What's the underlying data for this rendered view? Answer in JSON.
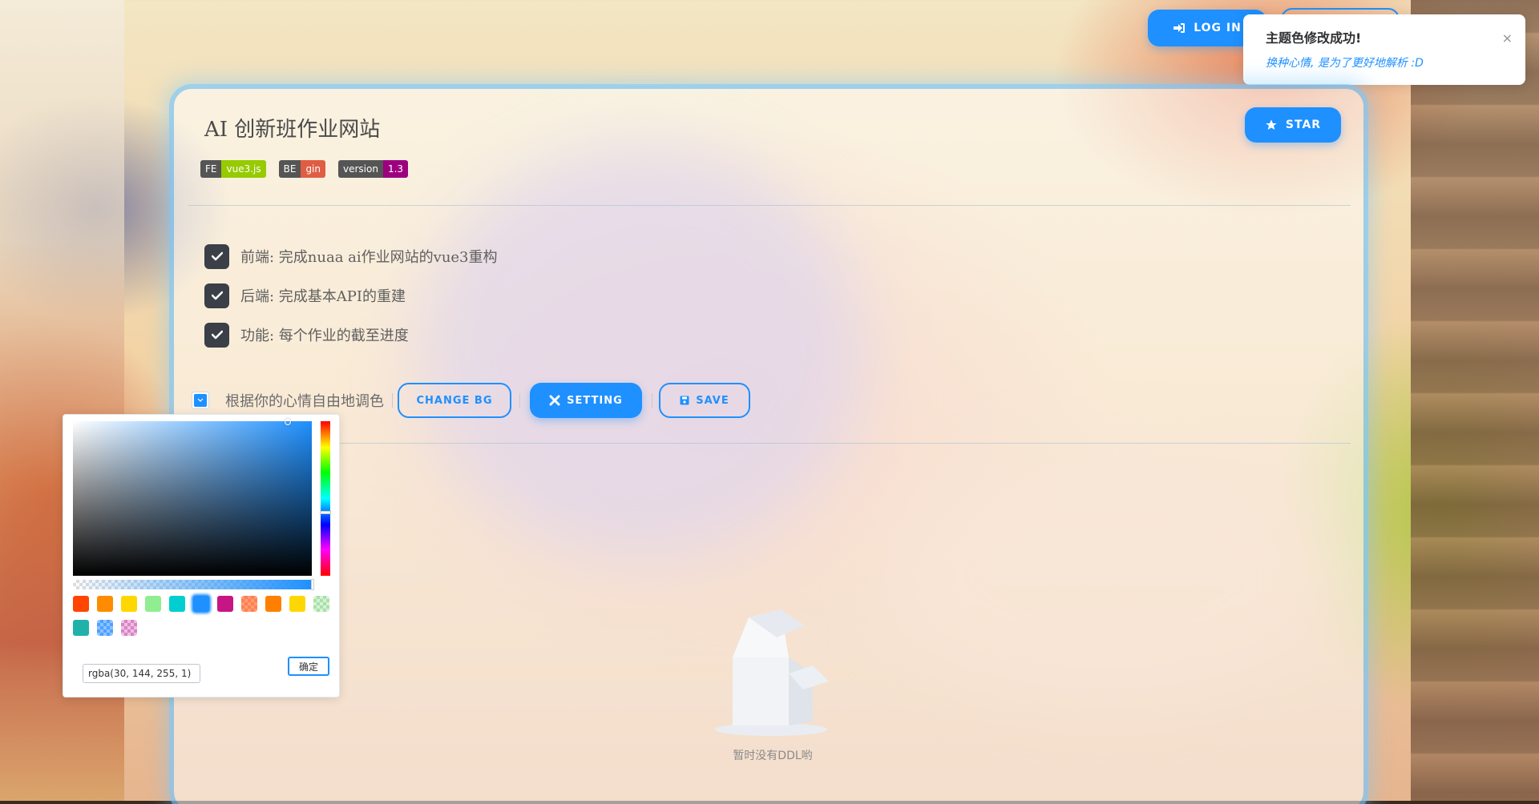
{
  "header": {
    "login_label": "LOG IN"
  },
  "toast": {
    "title": "主题色修改成功!",
    "message": "换种心情, 是为了更好地解析 :D",
    "close_symbol": "×"
  },
  "card": {
    "title": "AI 创新班作业网站",
    "star_label": "STAR",
    "badges": [
      {
        "key": "FE",
        "value": "vue3.js",
        "color": "#97ca00"
      },
      {
        "key": "BE",
        "value": "gin",
        "color": "#e05d44"
      },
      {
        "key": "version",
        "value": "1.3",
        "color": "#9c007f"
      }
    ],
    "tasks": [
      {
        "text": "前端: 完成nuaa ai作业网站的vue3重构",
        "checked": true
      },
      {
        "text": "后端: 完成基本API的重建",
        "checked": true
      },
      {
        "text": "功能: 每个作业的截至进度",
        "checked": true
      }
    ],
    "controls": {
      "mood_text": "根据你的心情自由地调色",
      "change_bg_label": "CHANGE BG",
      "setting_label": "SETTING",
      "save_label": "SAVE"
    },
    "empty": {
      "text": "暂时没有DDL哟"
    }
  },
  "color_picker": {
    "value": "rgba(30, 144, 255, 1)",
    "confirm_label": "确定",
    "selected_color": "#1e90ff",
    "swatches": [
      "#ff4500",
      "#ff8c00",
      "#ffd700",
      "#90ee90",
      "#00ced1",
      "#1e90ff",
      "#c71585",
      "#ff7f50",
      "#ff8000",
      "#ffd700",
      "#b9e6b9",
      "#20b2aa",
      "#6fb1ff",
      "#e29ad0"
    ]
  },
  "theme": {
    "accent": "#1e90ff"
  }
}
